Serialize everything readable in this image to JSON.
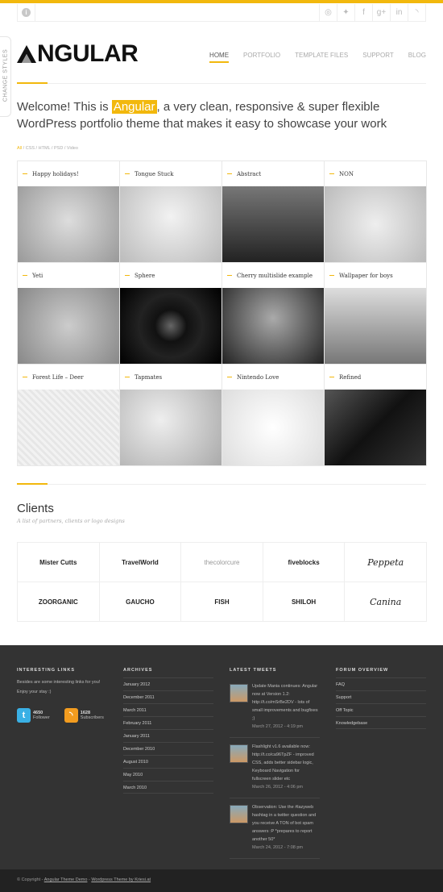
{
  "accent": "#f2b80d",
  "social": {
    "info_icon": "info-icon",
    "icons": [
      {
        "name": "dribbble-icon",
        "glyph": "◎"
      },
      {
        "name": "twitter-icon",
        "glyph": "✦"
      },
      {
        "name": "facebook-icon",
        "glyph": "f"
      },
      {
        "name": "google-plus-icon",
        "glyph": "g+"
      },
      {
        "name": "linkedin-icon",
        "glyph": "in"
      },
      {
        "name": "rss-icon",
        "glyph": "◝"
      }
    ]
  },
  "change_styles": "CHANGE STYLES",
  "logo": "NGULAR",
  "nav": [
    "HOME",
    "PORTFOLIO",
    "TEMPLATE FILES",
    "SUPPORT",
    "BLOG"
  ],
  "welcome": {
    "before": "Welcome! This is ",
    "highlight": "Angular",
    "after": ", a very clean, responsive & super flexible WordPress portfolio theme that makes it easy to showcase your work"
  },
  "filters": [
    "All",
    "CSS",
    "HTML",
    "PSD",
    "Video"
  ],
  "portfolio": [
    "Happy holidays!",
    "Tongue Stuck",
    "Abstract",
    "NON",
    "Yeti",
    "Sphere",
    "Cherry multislide example",
    "Wallpaper for boys",
    "Forest Life – Deer",
    "Tapmates",
    "Nintendo Love",
    "Refined"
  ],
  "clients": {
    "title": "Clients",
    "subtitle": "A list of partners, clients or logo designs",
    "logos": [
      "Mister Cutts",
      "TravelWorld",
      "thecolorcure",
      "fiveblocks",
      "Peppeta",
      "ZOORGANIC",
      "GAUCHO",
      "FISH",
      "SHILOH",
      "Canina"
    ]
  },
  "footer": {
    "links": {
      "title": "INTERESTING LINKS",
      "text": "Besides are some interesting links for you! Enjoy your stay :)",
      "twitter": {
        "count": "4650",
        "label": "Follower"
      },
      "rss": {
        "count": "1628",
        "label": "Subscribers"
      }
    },
    "archives": {
      "title": "ARCHIVES",
      "items": [
        "January 2012",
        "December 2011",
        "March 2011",
        "February 2011",
        "January 2011",
        "December 2010",
        "August 2010",
        "May 2010",
        "March 2010"
      ]
    },
    "tweets": {
      "title": "LATEST TWEETS",
      "items": [
        {
          "text": "Update Mania continues: Angular now at Version 1.2: http://t.co/mSrBe2DV - lots of small improvements and bugfixes ;)",
          "date": "March 27, 2012 - 4:19 pm"
        },
        {
          "text": "Flashlight v1.6 available now: http://t.co/ca96TpZF - improved CSS, adds better sidebar logic, Keyboard Navigation for fullscreen slider etc",
          "date": "March 26, 2012 - 4:06 pm"
        },
        {
          "text": "Observation: Use the #lazyweb hashtag in a twitter question and you receive A TON of bot spam answers :P *prepares to report another 50*",
          "date": "March 24, 2012 - 7:08 pm"
        }
      ]
    },
    "forum": {
      "title": "FORUM OVERVIEW",
      "items": [
        "FAQ",
        "Support",
        "Off Topic",
        "Knowledgebase"
      ]
    }
  },
  "bottom": {
    "copyright": "© Copyright - ",
    "link1": "Angular Theme Demo",
    "sep": " - ",
    "link2": "Wordpress Theme by Kriesi.at"
  }
}
